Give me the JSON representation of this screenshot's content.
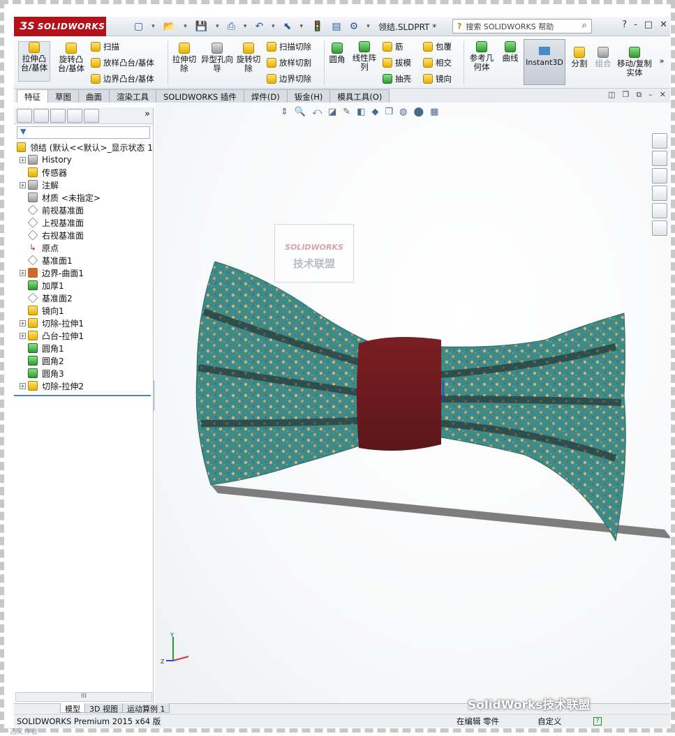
{
  "app": {
    "brand": "SOLIDWORKS",
    "doc_title": "领结.SLDPRT *",
    "search_placeholder": "搜索 SOLIDWORKS 帮助",
    "window_buttons": [
      "?",
      "-",
      "□",
      "✕"
    ]
  },
  "ribbon": {
    "big": [
      "拉伸凸台/基体",
      "旋转凸台/基体",
      "拉伸切除",
      "异型孔向导",
      "旋转切除",
      "圆角",
      "线性阵列",
      "参考几何体",
      "曲线",
      "Instant3D",
      "分割",
      "组合",
      "移动/复制实体"
    ],
    "small": [
      "扫描",
      "放样凸台/基体",
      "边界凸台/基体",
      "扫描切除",
      "放样切割",
      "边界切除",
      "筋",
      "拔模",
      "抽壳",
      "包覆",
      "相交",
      "镜向"
    ]
  },
  "tabs": [
    "特征",
    "草图",
    "曲面",
    "渲染工具",
    "SOLIDWORKS 插件",
    "焊件(D)",
    "钣金(H)",
    "模具工具(O)"
  ],
  "tree": {
    "root": "领结 (默认<<默认>_显示状态 1",
    "items": [
      "History",
      "传感器",
      "注解",
      "材质 <未指定>",
      "前视基准面",
      "上视基准面",
      "右视基准面",
      "原点",
      "基准面1",
      "边界-曲面1",
      "加厚1",
      "基准面2",
      "镜向1",
      "切除-拉伸1",
      "凸台-拉伸1",
      "圆角1",
      "圆角2",
      "圆角3",
      "切除-拉伸2"
    ]
  },
  "watermark": {
    "logo": "SOLIDWORKS",
    "text": "技术联盟"
  },
  "bottom_tabs": [
    "模型",
    "3D 视图",
    "运动算例 1"
  ],
  "status": {
    "product": "SOLIDWORKS Premium 2015 x64 版",
    "mode": "在编辑 零件",
    "units": "自定义",
    "check": "?"
  },
  "overlay": {
    "wechat": "SolidWorks技术联盟",
    "credit": "乙又作者"
  },
  "colors": {
    "brand_red": "#b3121c",
    "tie_teal": "#3e8a86",
    "band_red": "#7a1e22"
  }
}
